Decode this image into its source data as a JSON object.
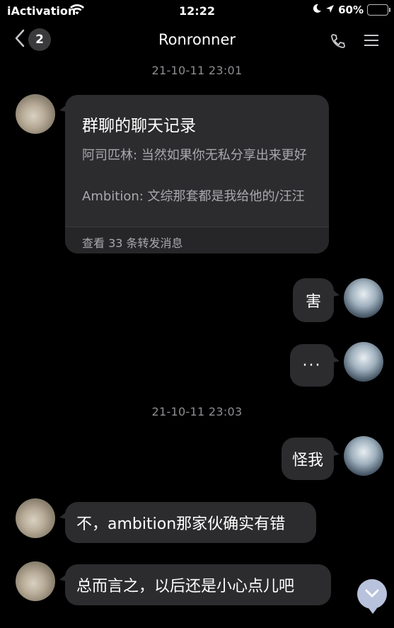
{
  "status_bar": {
    "carrier": "iActivation",
    "time": "12:22",
    "battery": "60%",
    "battery_level": 0.6,
    "icons": [
      "wifi-icon",
      "moon-icon",
      "location-arrow-icon",
      "battery-charging-icon"
    ]
  },
  "nav": {
    "unread_count": "2",
    "title": "Ronronner",
    "icons": [
      "chevron-left-icon",
      "phone-icon",
      "menu-icon"
    ]
  },
  "messages": {
    "time1": "21-10-11 23:01",
    "forward": {
      "title": "群聊的聊天记录",
      "line1": "阿司匹林: 当然如果你无私分享出来更好",
      "line2": "Ambition: 文综那套都是我给他的/汪汪",
      "footer": "查看 33 条转发消息"
    },
    "msg_hai": "害",
    "msg_dots": "···",
    "time2": "21-10-11 23:03",
    "msg_guaiwo": "怪我",
    "msg_bu": "不，ambition那家伙确实有错",
    "msg_zong": "总而言之，以后还是小心点儿吧"
  },
  "colors": {
    "background": "#000000",
    "bubble": "#2c2c2e",
    "timestamp": "#8e8e93",
    "scroll_button": "#b8c2dc"
  }
}
